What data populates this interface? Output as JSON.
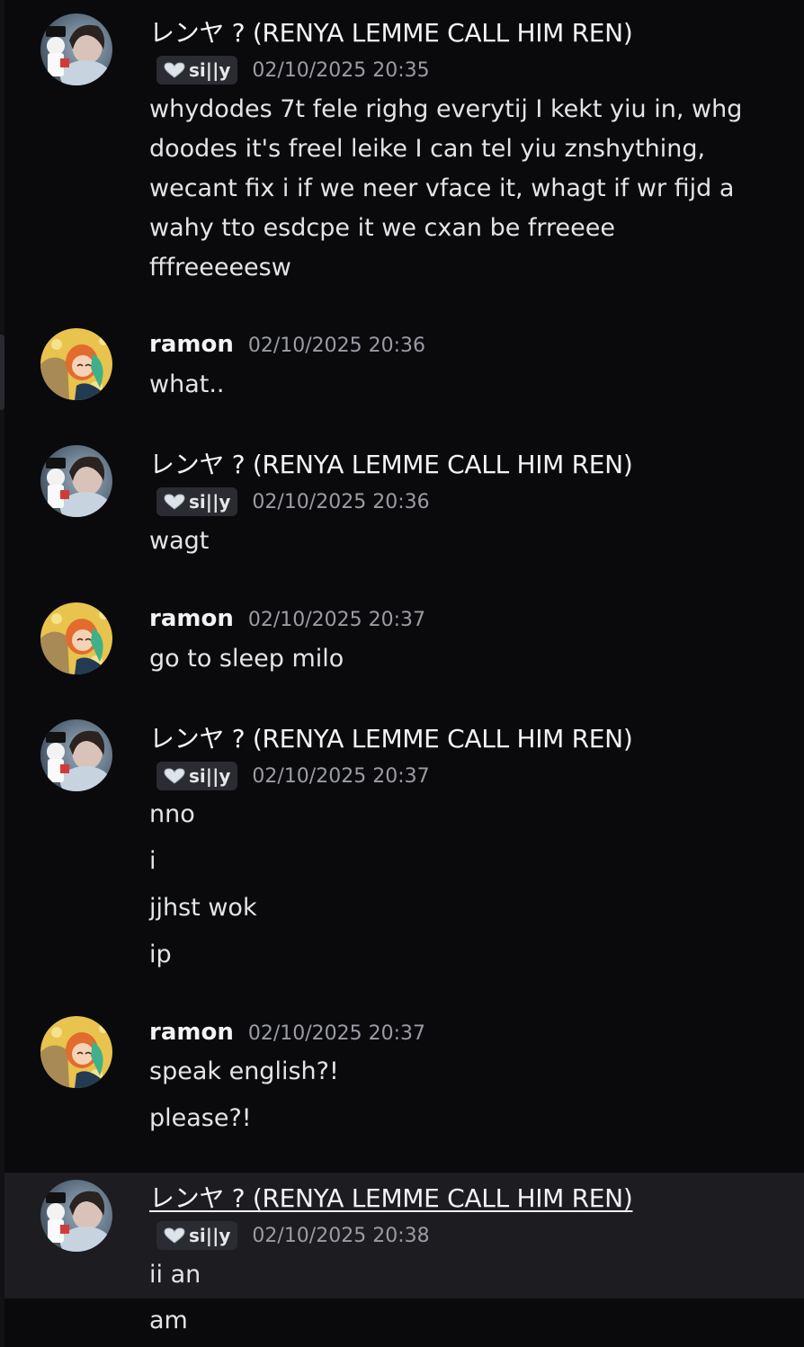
{
  "user_ren": {
    "name": "レンヤ ? (RENYA LEMME CALL HIM REN)",
    "tag": "si||y"
  },
  "user_ramon": {
    "name": "ramon"
  },
  "messages": [
    {
      "timestamp": "02/10/2025 20:35",
      "lines": [
        "whydodes 7t fele righg everytij I kekt yiu in, whg",
        "doodes it's freel leike I can tel yiu znshything,",
        "wecant fix i if we neer vface it, whagt if wr fijd a",
        "wahy tto esdcpe it we cxan be frreeee",
        "fffreeeeesw"
      ]
    },
    {
      "timestamp": "02/10/2025 20:36",
      "lines": [
        "what.."
      ]
    },
    {
      "timestamp": "02/10/2025 20:36",
      "lines": [
        "wagt"
      ]
    },
    {
      "timestamp": "02/10/2025 20:37",
      "lines": [
        "go to sleep milo"
      ]
    },
    {
      "timestamp": "02/10/2025 20:37",
      "lines": [
        "nno",
        "i",
        "jjhst wok",
        "ip"
      ]
    },
    {
      "timestamp": "02/10/2025 20:37",
      "lines": [
        "speak english?!",
        "please?!"
      ]
    },
    {
      "timestamp": "02/10/2025 20:38",
      "lines": [
        "ii an",
        "am"
      ]
    }
  ],
  "colors": {
    "background": "#0a0a0c",
    "highlight": "#1c1c21",
    "tag_bg": "#2b2c31",
    "timestamp": "#9a9ca4"
  }
}
